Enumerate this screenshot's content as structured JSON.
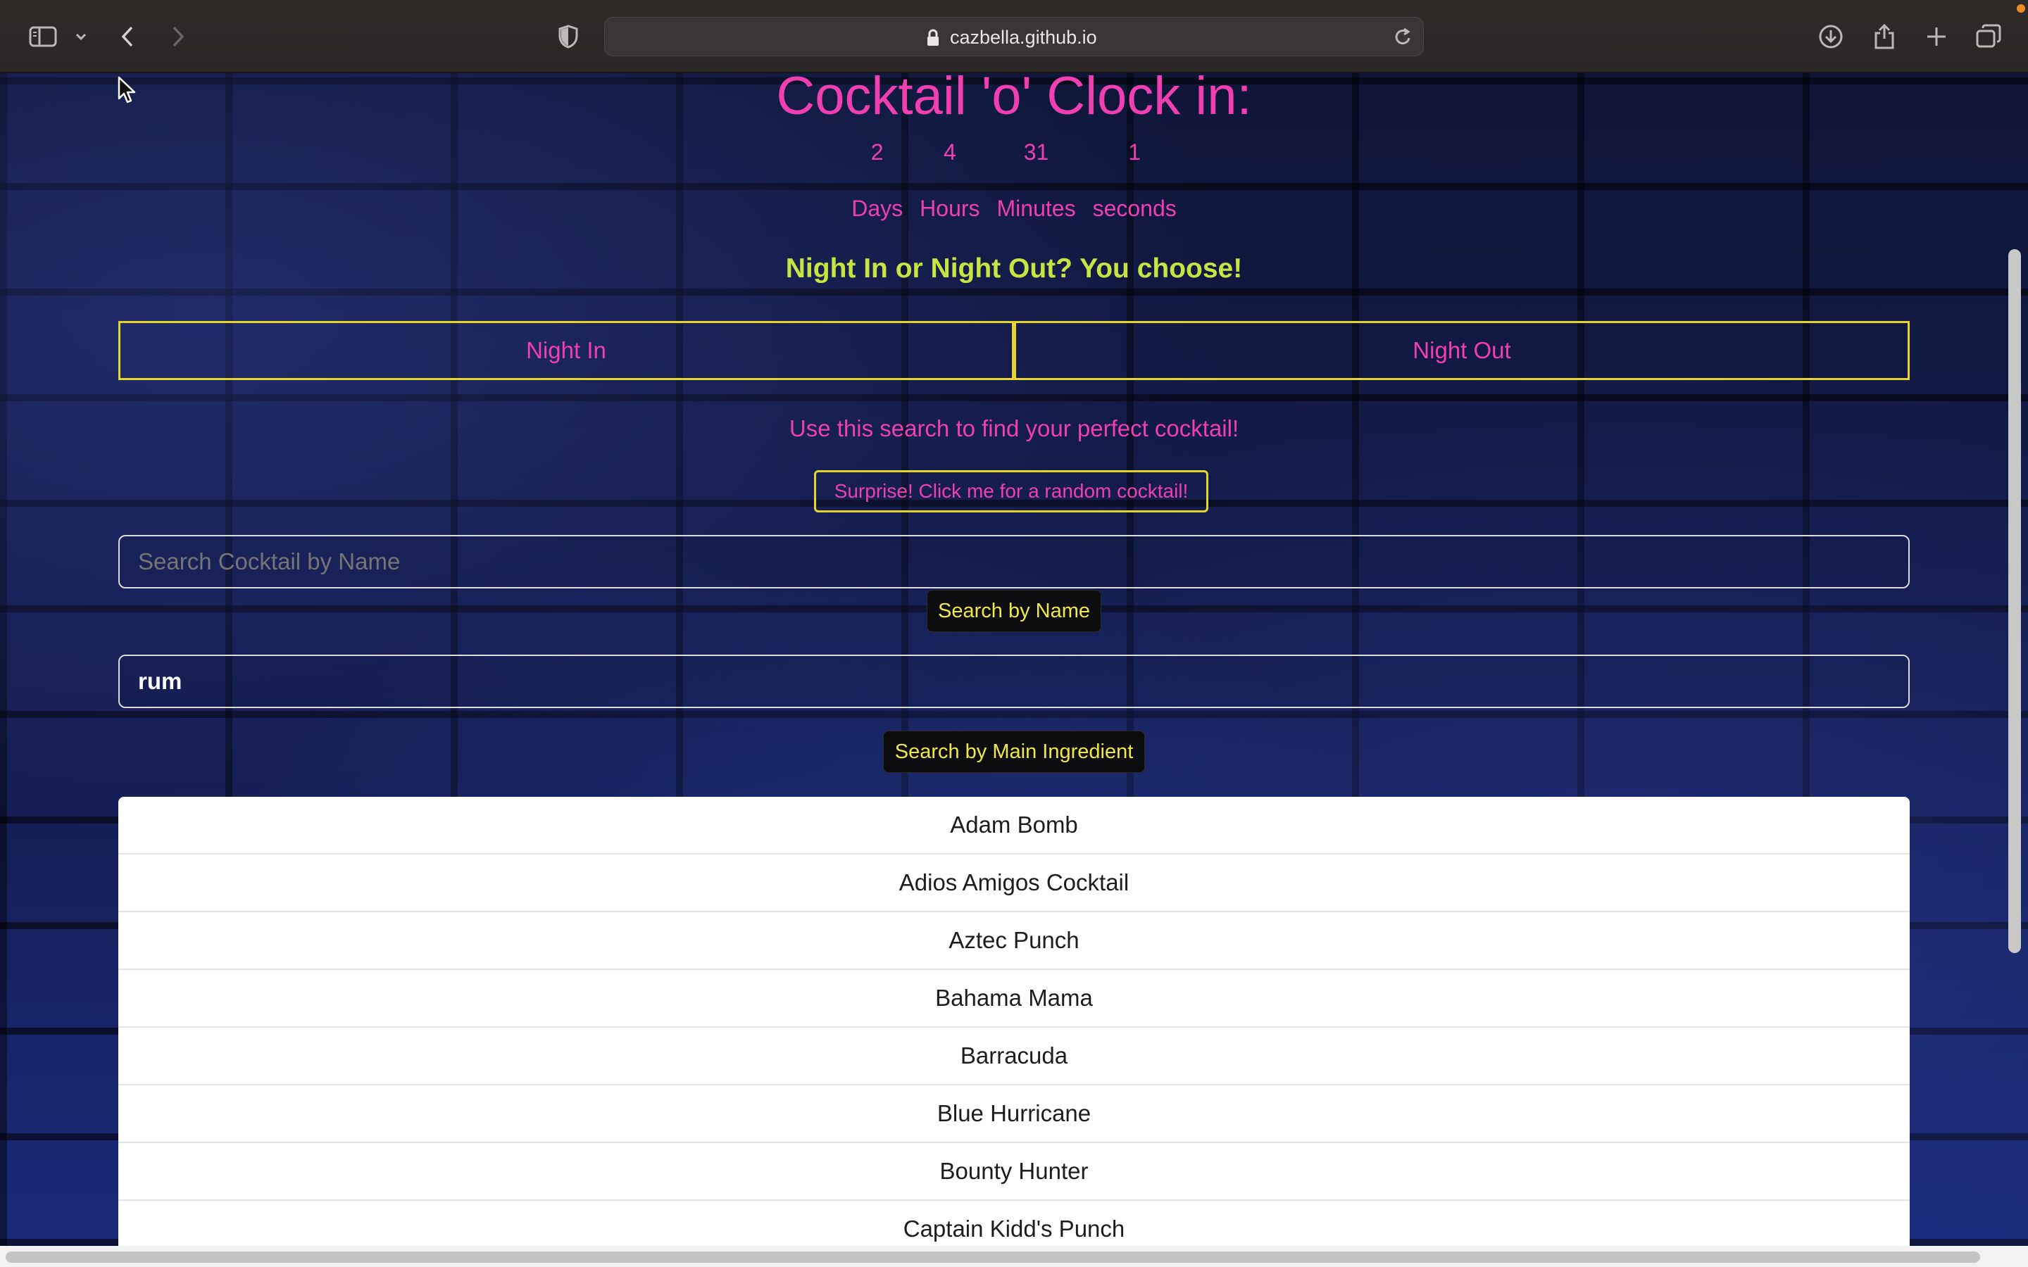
{
  "browser": {
    "url": "cazbella.github.io"
  },
  "page": {
    "title": "Cocktail 'o' Clock in:",
    "countdown": [
      {
        "value": "2",
        "label": "Days"
      },
      {
        "value": "4",
        "label": "Hours"
      },
      {
        "value": "31",
        "label": "Minutes"
      },
      {
        "value": "1",
        "label": "seconds"
      }
    ],
    "tagline": "Night In or Night Out? You choose!",
    "night_in": "Night In",
    "night_out": "Night Out",
    "hint": "Use this search to find your perfect cocktail!",
    "surprise_button": "Surprise! Click me for a random cocktail!",
    "name_search": {
      "placeholder": "Search Cocktail by Name",
      "value": ""
    },
    "name_button": "Search by Name",
    "ingredient_search": {
      "value": "rum"
    },
    "ingredient_button": "Search by Main Ingredient",
    "results": [
      "Adam Bomb",
      "Adios Amigos Cocktail",
      "Aztec Punch",
      "Bahama Mama",
      "Barracuda",
      "Blue Hurricane",
      "Bounty Hunter",
      "Captain Kidd's Punch"
    ]
  }
}
